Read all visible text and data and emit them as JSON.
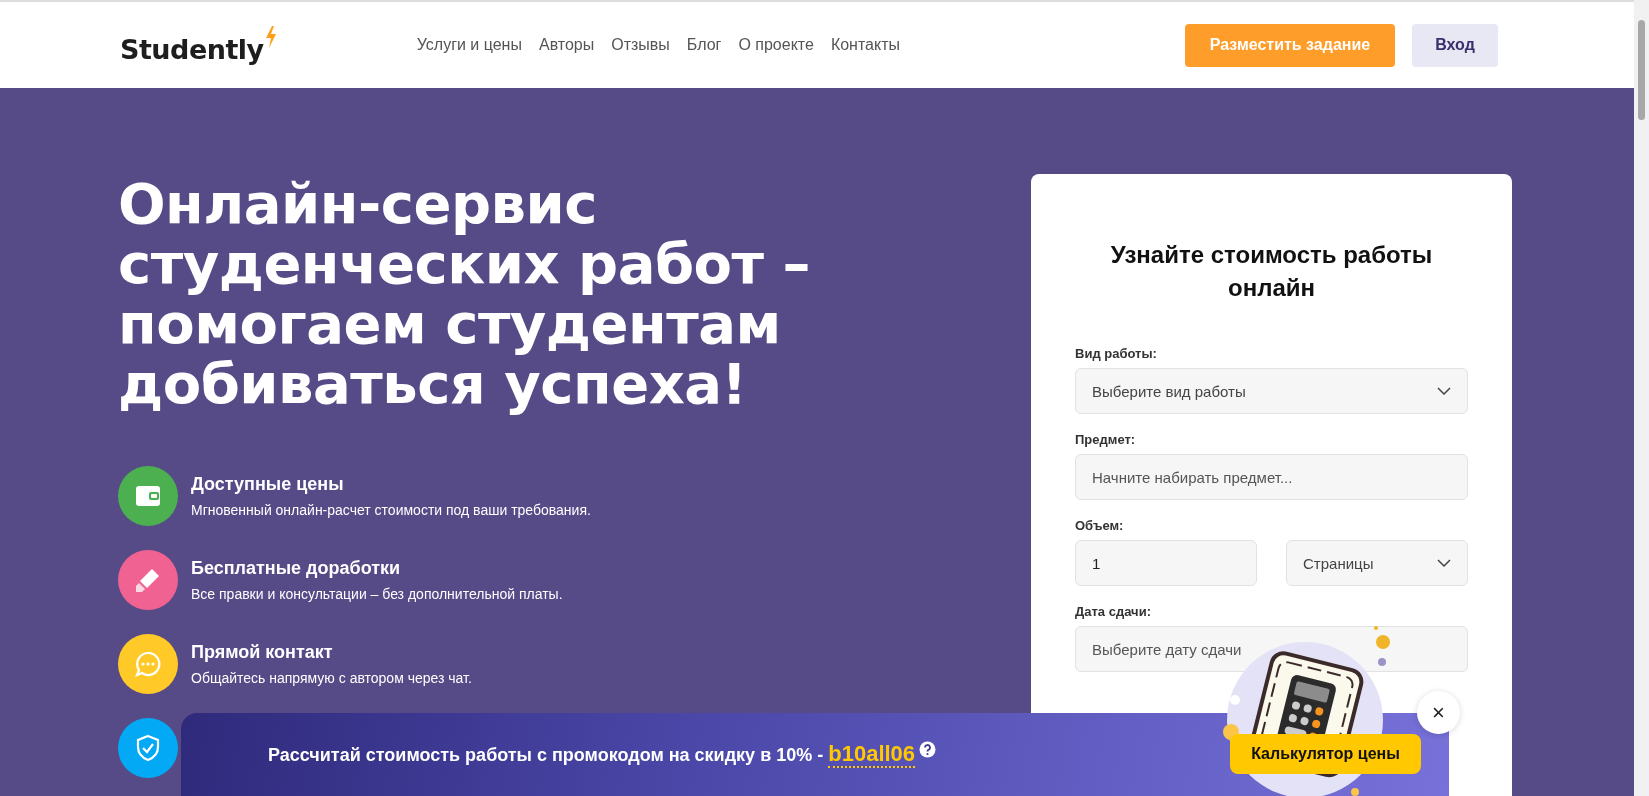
{
  "header": {
    "logo": "Studently",
    "nav": [
      "Услуги и цены",
      "Авторы",
      "Отзывы",
      "Блог",
      "О проекте",
      "Контакты"
    ],
    "primary_button": "Разместить задание",
    "login_button": "Вход"
  },
  "hero": {
    "title_lines": [
      "Онлайн-сервис",
      "студенческих работ –",
      "помогаем студентам",
      "добиваться успеха!"
    ],
    "features": [
      {
        "kind": "wallet",
        "color": "#4caf50",
        "title": "Доступные цены",
        "text": "Мгновенный онлайн-расчет стоимости под ваши требования."
      },
      {
        "kind": "marker",
        "color": "#f06292",
        "title": "Бесплатные доработки",
        "text": "Все правки и консультации – без дополнительной платы."
      },
      {
        "kind": "chat",
        "color": "#ffca28",
        "title": "Прямой контакт",
        "text": "Общайтесь напрямую с автором через чат."
      },
      {
        "kind": "shield",
        "color": "#03a9f4"
      }
    ]
  },
  "form": {
    "title": "Узнайте стоимость работы онлайн",
    "fields": [
      {
        "kind": "select",
        "label": "Вид работы:",
        "placeholder": "Выберите вид работы"
      },
      {
        "kind": "text",
        "label": "Предмет:",
        "placeholder": "Начните набирать предмет..."
      },
      {
        "kind": "pair",
        "label": "Объем:",
        "value": "1",
        "unit": "Страницы"
      },
      {
        "kind": "text",
        "label": "Дата сдачи:",
        "placeholder": "Выберите дату сдачи"
      }
    ]
  },
  "promo": {
    "text": "Рассчитай стоимость работы с промокодом на скидку в 10% - ",
    "code": "b10all06",
    "button": "Калькулятор цены",
    "close": "×"
  }
}
